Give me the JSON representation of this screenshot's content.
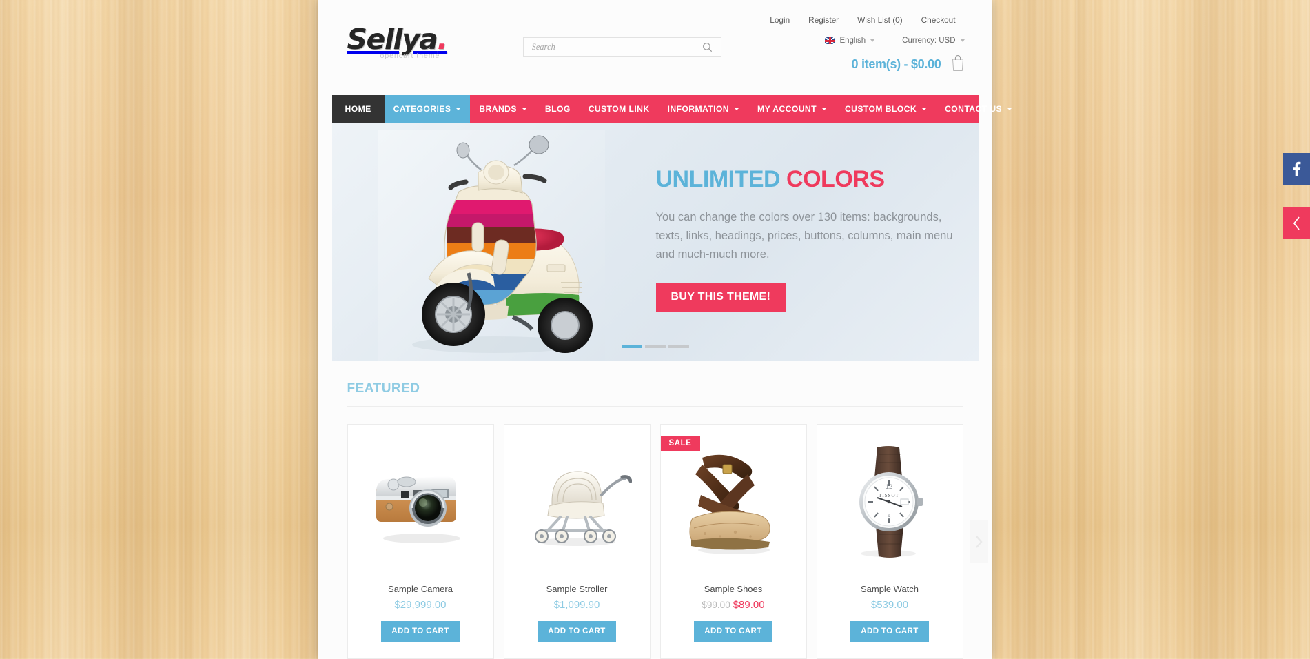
{
  "brand": {
    "logo_word": "Sellya",
    "logo_dot": ".",
    "logo_subtitle": "opencart theme"
  },
  "search": {
    "placeholder": "Search",
    "value": "",
    "icon": "search-icon"
  },
  "toplinks": [
    {
      "label": "Login"
    },
    {
      "label": "Register"
    },
    {
      "label": "Wish List (0)"
    },
    {
      "label": "Checkout"
    }
  ],
  "prefs": {
    "language": {
      "label": "English",
      "flag": "uk-flag-icon"
    },
    "currency": {
      "label": "Currency: USD"
    }
  },
  "cart": {
    "text": "0 item(s) - $0.00",
    "icon": "shopping-bag-icon"
  },
  "nav": [
    {
      "label": "HOME",
      "state": "home",
      "caret": false
    },
    {
      "label": "CATEGORIES",
      "state": "active",
      "caret": true
    },
    {
      "label": "BRANDS",
      "state": "",
      "caret": true
    },
    {
      "label": "BLOG",
      "state": "",
      "caret": false
    },
    {
      "label": "CUSTOM LINK",
      "state": "",
      "caret": false
    },
    {
      "label": "INFORMATION",
      "state": "",
      "caret": true
    },
    {
      "label": "MY ACCOUNT",
      "state": "",
      "caret": true
    },
    {
      "label": "CUSTOM BLOCK",
      "state": "",
      "caret": true
    },
    {
      "label": "CONTACT US",
      "state": "",
      "caret": true
    }
  ],
  "banner": {
    "title_part1": "UNLIMITED ",
    "title_part2": "COLORS",
    "description": "You can change the colors over 130 items: backgrounds, texts, links, headings, prices, buttons, columns, main menu and much-much more.",
    "button_label": "BUY THIS THEME!",
    "image": "rainbow-scooter-image",
    "slides_total": 3,
    "slide_active": 1
  },
  "featured": {
    "heading": "FEATURED",
    "next_arrow": "chevron-right-icon",
    "products": [
      {
        "name": "Sample Camera",
        "price": "$29,999.00",
        "old_price": "",
        "sale": false,
        "badge": "",
        "button": "ADD TO CART",
        "image": "camera-image"
      },
      {
        "name": "Sample Stroller",
        "price": "$1,099.90",
        "old_price": "",
        "sale": false,
        "badge": "",
        "button": "ADD TO CART",
        "image": "stroller-image"
      },
      {
        "name": "Sample Shoes",
        "price": "$89.00",
        "old_price": "$99.00",
        "sale": true,
        "badge": "SALE",
        "button": "ADD TO CART",
        "image": "wedge-sandal-image"
      },
      {
        "name": "Sample Watch",
        "price": "$539.00",
        "old_price": "",
        "sale": false,
        "badge": "",
        "button": "ADD TO CART",
        "image": "wristwatch-image"
      }
    ]
  },
  "social_rail": [
    {
      "name": "facebook-button",
      "icon": "facebook-icon",
      "color": "#3b5998"
    },
    {
      "name": "collapse-button",
      "icon": "chevron-left-icon",
      "color": "#ef3a5d"
    }
  ],
  "colors": {
    "primary_pink": "#ef3a5d",
    "accent_blue": "#5cb3d9",
    "nav_home_dark": "#333333",
    "page_bg": "#fcfcfc",
    "facebook_blue": "#3b5998"
  }
}
